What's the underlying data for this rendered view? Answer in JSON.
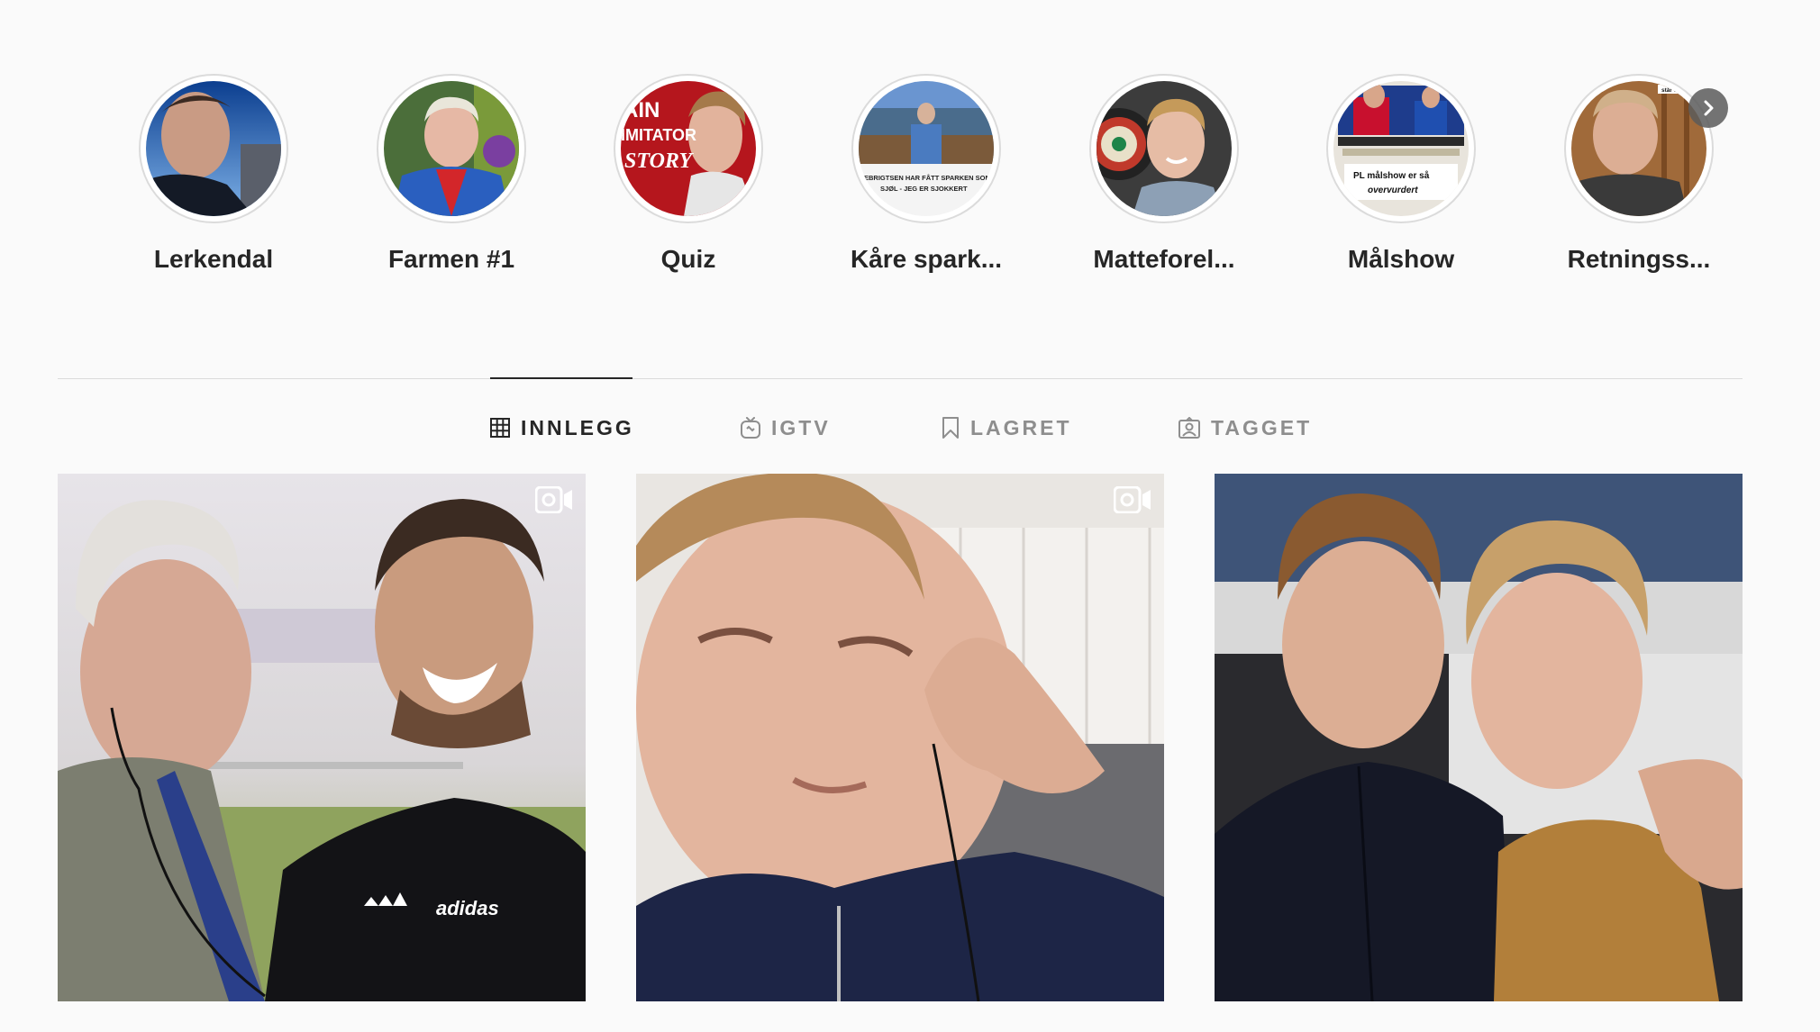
{
  "highlights": [
    {
      "title": "Lerkendal",
      "icon": "highlight-cover-selfie"
    },
    {
      "title": "Farmen #1",
      "icon": "highlight-cover-man-blue-jacket"
    },
    {
      "title": "Quiz",
      "icon": "highlight-cover-quiz"
    },
    {
      "title": "Kåre spark...",
      "icon": "highlight-cover-news-clip"
    },
    {
      "title": "Matteforel...",
      "icon": "highlight-cover-dartboard"
    },
    {
      "title": "Målshow",
      "icon": "highlight-cover-tv"
    },
    {
      "title": "Retningss...",
      "icon": "highlight-cover-selfie-wood"
    }
  ],
  "highlight_overlays": {
    "quiz_line1": "AIN",
    "quiz_line2": "IMITATOR",
    "quiz_line3": "STORY",
    "news_line1": "EBRIGTSEN HAR FÅTT SPARKEN SOM PF",
    "news_line2": "SJØL - JEG ER SJOKKERT",
    "tv_line1": "PL målshow er så",
    "tv_line2": "overvurdert",
    "wood_line1": "står til temm"
  },
  "tabs": [
    {
      "label": "INNLEGG",
      "icon": "grid-icon",
      "active": true
    },
    {
      "label": "IGTV",
      "icon": "igtv-icon",
      "active": false
    },
    {
      "label": "LAGRET",
      "icon": "bookmark-icon",
      "active": false
    },
    {
      "label": "TAGGET",
      "icon": "tagged-icon",
      "active": false
    }
  ],
  "posts": [
    {
      "type": "video",
      "icon": "post-image-interview",
      "jacket_brand": "adidas"
    },
    {
      "type": "video",
      "icon": "post-image-selfie"
    },
    {
      "type": "photo",
      "icon": "post-image-two-friends"
    }
  ],
  "colors": {
    "background": "#fafafa",
    "text": "#262626",
    "muted": "#8e8e8e",
    "border": "#dbdbdb"
  }
}
